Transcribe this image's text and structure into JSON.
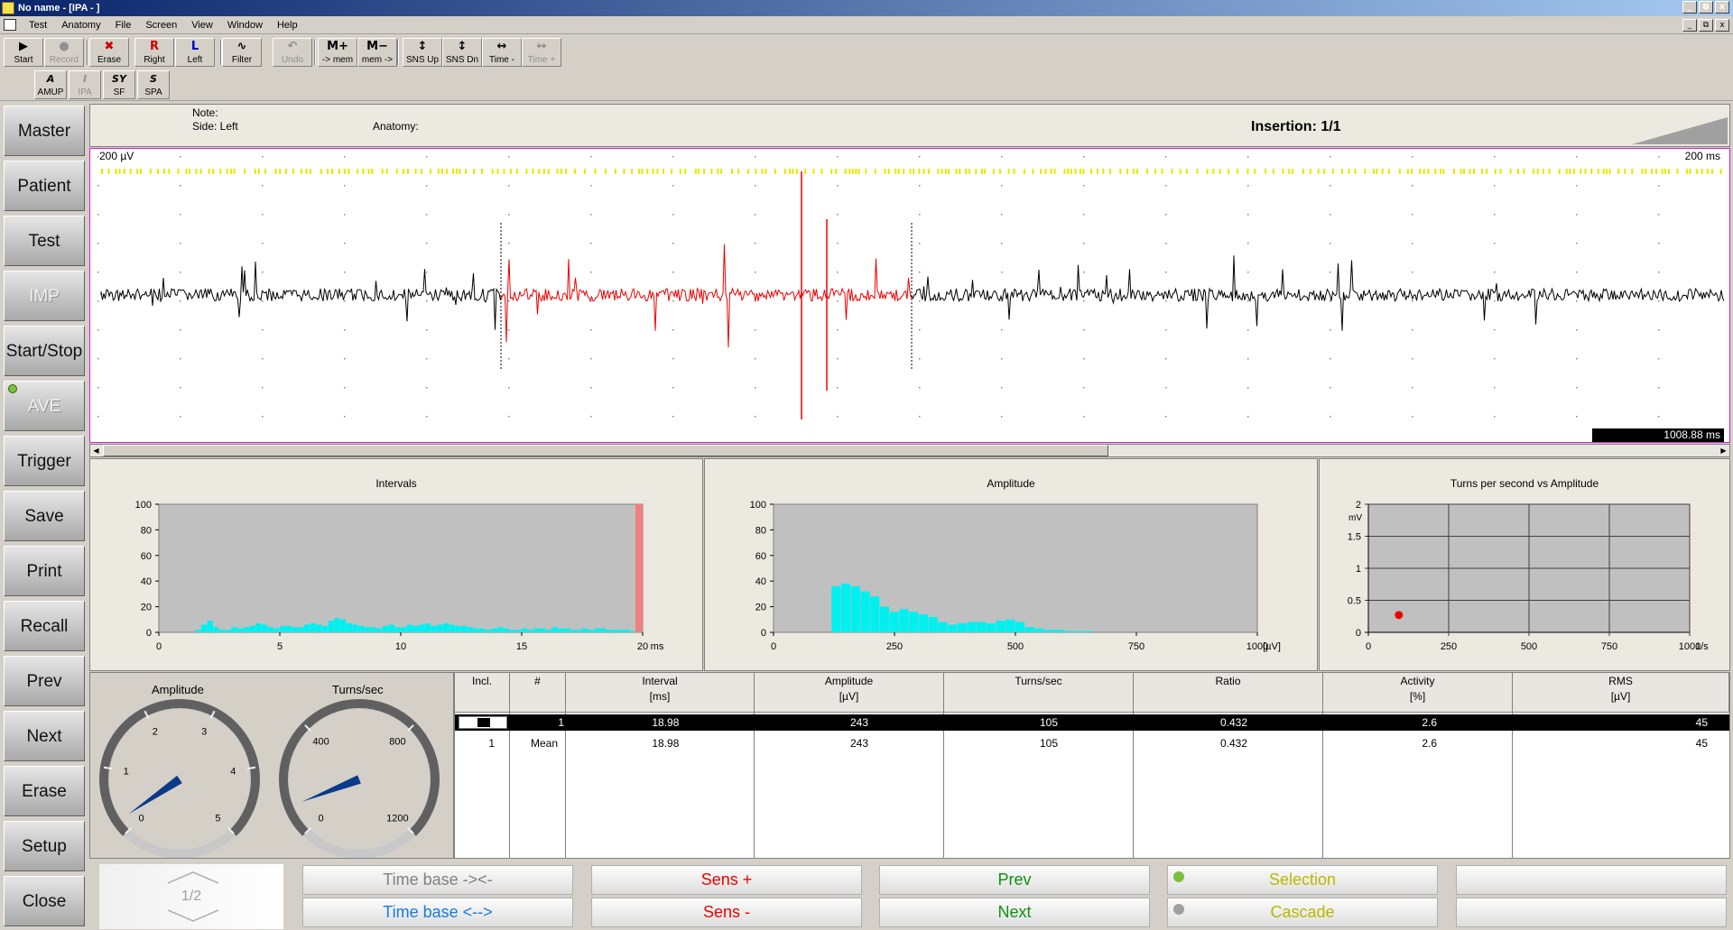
{
  "window": {
    "title": "No name - [IPA - ]",
    "controls": [
      "_",
      "⧉",
      "x"
    ]
  },
  "menu": [
    "Test",
    "Anatomy",
    "File",
    "Screen",
    "View",
    "Window",
    "Help"
  ],
  "toolbar1": [
    {
      "label": "Start",
      "glyph": "▶",
      "color": "#000000",
      "enabled": true
    },
    {
      "label": "Record",
      "glyph": "●",
      "color": "#909090",
      "enabled": false
    },
    {
      "label": "Erase",
      "glyph": "✖",
      "color": "#cc0000",
      "enabled": true
    },
    {
      "label": "Right",
      "glyph": "R",
      "color": "#cc0000",
      "enabled": true
    },
    {
      "label": "Left",
      "glyph": "L",
      "color": "#0000cc",
      "enabled": true
    },
    {
      "label": "Filter",
      "glyph": "∿",
      "color": "#000000",
      "enabled": true
    },
    {
      "label": "Undo",
      "glyph": "↶",
      "color": "#909090",
      "enabled": false
    },
    {
      "label": "-> mem",
      "glyph": "M+",
      "color": "#000000",
      "enabled": true
    },
    {
      "label": "mem ->",
      "glyph": "M−",
      "color": "#000000",
      "enabled": true
    },
    {
      "label": "SNS Up",
      "glyph": "↕",
      "color": "#000000",
      "enabled": true
    },
    {
      "label": "SNS Dn",
      "glyph": "↕",
      "color": "#000000",
      "enabled": true
    },
    {
      "label": "Time -",
      "glyph": "↔",
      "color": "#000000",
      "enabled": true
    },
    {
      "label": "Time +",
      "glyph": "↔",
      "color": "#909090",
      "enabled": false
    }
  ],
  "toolbar2": [
    {
      "label": "AMUP",
      "glyph": "A",
      "enabled": true
    },
    {
      "label": "IPA",
      "glyph": "I",
      "enabled": false
    },
    {
      "label": "SF",
      "glyph": "SY",
      "enabled": true
    },
    {
      "label": "SPA",
      "glyph": "S",
      "enabled": true
    }
  ],
  "sidebar": [
    {
      "label": "Master",
      "enabled": true,
      "led": false
    },
    {
      "label": "Patient",
      "enabled": true,
      "led": false
    },
    {
      "label": "Test",
      "enabled": true,
      "led": false
    },
    {
      "label": "IMP",
      "enabled": false,
      "led": false
    },
    {
      "label": "Start/Stop",
      "enabled": true,
      "led": false
    },
    {
      "label": "AVE",
      "enabled": false,
      "led": true
    },
    {
      "label": "Trigger",
      "enabled": true,
      "led": false
    },
    {
      "label": "Save",
      "enabled": true,
      "led": false
    },
    {
      "label": "Print",
      "enabled": true,
      "led": false
    },
    {
      "label": "Recall",
      "enabled": true,
      "led": false
    },
    {
      "label": "Prev",
      "enabled": true,
      "led": false
    },
    {
      "label": "Next",
      "enabled": true,
      "led": false
    },
    {
      "label": "Erase",
      "enabled": true,
      "led": false
    },
    {
      "label": "Setup",
      "enabled": true,
      "led": false
    },
    {
      "label": "Close",
      "enabled": true,
      "led": false
    }
  ],
  "info": {
    "note": "Note:",
    "side": "Side: Left",
    "anatomy": "Anatomy:",
    "insertion": "Insertion: 1/1"
  },
  "waveform": {
    "sensitivity": "200 µV",
    "timebase": "200 ms",
    "position": "1008.88 ms",
    "trace_color": "#000000",
    "selection_color": "#ee0000",
    "marker_color": "#e8e800"
  },
  "histograms": [
    {
      "title": "Intervals",
      "xlabel_unit": "ms",
      "ymax": 100,
      "yticks": [
        "100",
        "80",
        "60",
        "40",
        "20",
        "0"
      ],
      "xticks": [
        "0",
        "5",
        "10",
        "15",
        "20"
      ],
      "xmax": 20,
      "bin_width": 0.25,
      "bars": [
        0,
        0,
        0,
        0,
        0,
        0,
        0,
        0,
        0,
        0,
        0,
        0,
        0,
        0,
        0,
        0,
        0,
        0,
        0,
        0,
        0,
        0,
        0,
        0,
        0,
        0,
        0,
        0,
        0,
        0,
        0,
        0,
        0,
        0,
        0,
        0,
        0,
        0,
        0,
        0,
        0,
        0,
        0,
        0,
        0,
        0,
        0,
        0,
        0,
        0,
        0,
        0,
        0,
        0,
        0,
        0,
        0,
        0,
        0,
        0,
        0,
        0,
        0,
        0,
        0,
        0,
        0,
        0,
        0,
        0,
        0,
        0,
        0,
        0,
        0,
        0,
        0,
        0,
        0,
        0
      ],
      "values": [
        0,
        0,
        0,
        0,
        0,
        0,
        2,
        6,
        9,
        4,
        2,
        2,
        4,
        3,
        4,
        5,
        7,
        6,
        4,
        3,
        5,
        5,
        4,
        4,
        6,
        7,
        6,
        5,
        9,
        11,
        10,
        7,
        6,
        5,
        4,
        4,
        3,
        5,
        6,
        4,
        4,
        6,
        5,
        6,
        7,
        5,
        6,
        7,
        6,
        5,
        5,
        4,
        3,
        3,
        2,
        3,
        4,
        3,
        2,
        2,
        3,
        2,
        3,
        3,
        2,
        4,
        3,
        3,
        2,
        2,
        3,
        2,
        3,
        3,
        2,
        2,
        2,
        2,
        1,
        1
      ],
      "bar_color": "#00f0f0",
      "highlight": {
        "x": 20,
        "value": 100,
        "color": "#f08080"
      }
    },
    {
      "title": "Amplitude",
      "xlabel_unit": "[µV]",
      "ymax": 100,
      "yticks": [
        "100",
        "80",
        "60",
        "40",
        "20",
        "0"
      ],
      "xticks": [
        "0",
        "250",
        "500",
        "750",
        "1000"
      ],
      "xmax": 1000,
      "bin_width": 20,
      "values": [
        0,
        0,
        0,
        0,
        0,
        0,
        36,
        38,
        36,
        32,
        28,
        20,
        16,
        18,
        16,
        14,
        12,
        8,
        6,
        7,
        8,
        8,
        7,
        9,
        10,
        8,
        4,
        3,
        2,
        2,
        1,
        1,
        1,
        0,
        0,
        0,
        0,
        0,
        0,
        0,
        0,
        0,
        0,
        0,
        0,
        0,
        0,
        0,
        0,
        0
      ],
      "bar_color": "#00f0f0",
      "highlight": null
    }
  ],
  "scatter": {
    "title": "Turns per second vs Amplitude",
    "yunit": "mV",
    "xunit": "1/s",
    "yticks": [
      "2",
      "1.5",
      "1",
      "0.5",
      "0"
    ],
    "xticks": [
      "0",
      "250",
      "500",
      "750",
      "1000"
    ],
    "xmax": 1000,
    "ymax": 2,
    "points": [
      {
        "x": 95,
        "y": 0.27
      }
    ],
    "point_color": "#ee0000"
  },
  "gauges": [
    {
      "title": "Amplitude",
      "ticks": [
        "0",
        "1",
        "2",
        "3",
        "4",
        "5"
      ],
      "value": 0.2,
      "min": 0,
      "max": 5
    },
    {
      "title": "Turns/sec",
      "ticks": [
        "0",
        "400",
        "800",
        "1200"
      ],
      "value": 105,
      "min": 0,
      "max": 1200
    }
  ],
  "table": {
    "columns": [
      {
        "line1": "Incl.",
        "line2": ""
      },
      {
        "line1": "#",
        "line2": ""
      },
      {
        "line1": "Interval",
        "line2": "[ms]"
      },
      {
        "line1": "Amplitude",
        "line2": "[µV]"
      },
      {
        "line1": "Turns/sec",
        "line2": ""
      },
      {
        "line1": "Ratio",
        "line2": ""
      },
      {
        "line1": "Activity",
        "line2": "[%]"
      },
      {
        "line1": "RMS",
        "line2": "[µV]"
      }
    ],
    "rows": [
      {
        "incl": "",
        "num": "1",
        "interval": "18.98",
        "amplitude": "243",
        "turns": "105",
        "ratio": "0.432",
        "activity": "2.6",
        "rms": "45",
        "selected": true
      },
      {
        "incl": "1",
        "num": "Mean",
        "interval": "18.98",
        "amplitude": "243",
        "turns": "105",
        "ratio": "0.432",
        "activity": "2.6",
        "rms": "45",
        "selected": false
      }
    ]
  },
  "softkeys": {
    "page": "1/2",
    "keys": [
      {
        "label": "Time base -><-",
        "color": "#808080",
        "led": null
      },
      {
        "label": "Time base <-->",
        "color": "#1a7ae0",
        "led": null
      },
      {
        "label": "Sens +",
        "color": "#ee0000",
        "led": null
      },
      {
        "label": "Sens -",
        "color": "#ee0000",
        "led": null
      },
      {
        "label": "Prev",
        "color": "#109010",
        "led": null
      },
      {
        "label": "Next",
        "color": "#109010",
        "led": null
      },
      {
        "label": "Selection",
        "color": "#b8b800",
        "led": "#7cc040"
      },
      {
        "label": "Cascade",
        "color": "#b8b800",
        "led": "#a0a0a0"
      },
      {
        "label": "",
        "color": "#000000",
        "led": null
      },
      {
        "label": "",
        "color": "#000000",
        "led": null
      }
    ]
  }
}
